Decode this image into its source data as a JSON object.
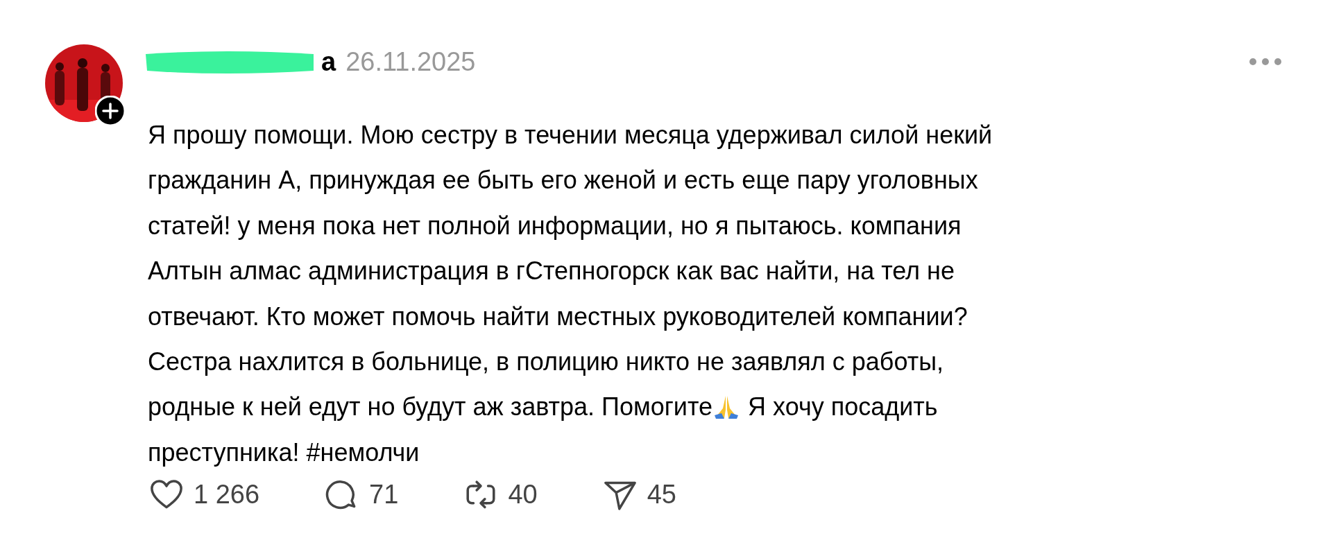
{
  "post": {
    "author": {
      "name": "а",
      "redacted": true
    },
    "date": "26.11.2025",
    "body_lines": [
      [
        {
          "kind": "text",
          "text": "Я прошу помощи. Мою сестру в течении месяца удерживал силой некий"
        }
      ],
      [
        {
          "kind": "text",
          "text": "гражданин А, принуждая ее быть его женой и есть еще пару уголовных"
        }
      ],
      [
        {
          "kind": "text",
          "text": "статей! у меня пока нет полной информации, но я пытаюсь. компания"
        }
      ],
      [
        {
          "kind": "text",
          "text": "Алтын алмас администрация в гСтепногорск как вас найти, на тел не"
        }
      ],
      [
        {
          "kind": "text",
          "text": "отвечают. Кто может помочь найти местных руководителей компании?"
        }
      ],
      [
        {
          "kind": "text",
          "text": "Сестра нахлится в больнице, в полицию никто не заявлял с работы,"
        }
      ],
      [
        {
          "kind": "text",
          "text": "родные к ней едут но будут аж завтра. Помогите"
        },
        {
          "kind": "emoji"
        },
        {
          "kind": "text",
          "text": "Я хочу посадить"
        }
      ],
      [
        {
          "kind": "text",
          "text": "преступника! #немолчи"
        }
      ]
    ],
    "actions": [
      {
        "kind": "like",
        "count": "1 266"
      },
      {
        "kind": "comment",
        "count": "71"
      },
      {
        "kind": "repost",
        "count": "40"
      },
      {
        "kind": "share",
        "count": "45"
      }
    ]
  }
}
